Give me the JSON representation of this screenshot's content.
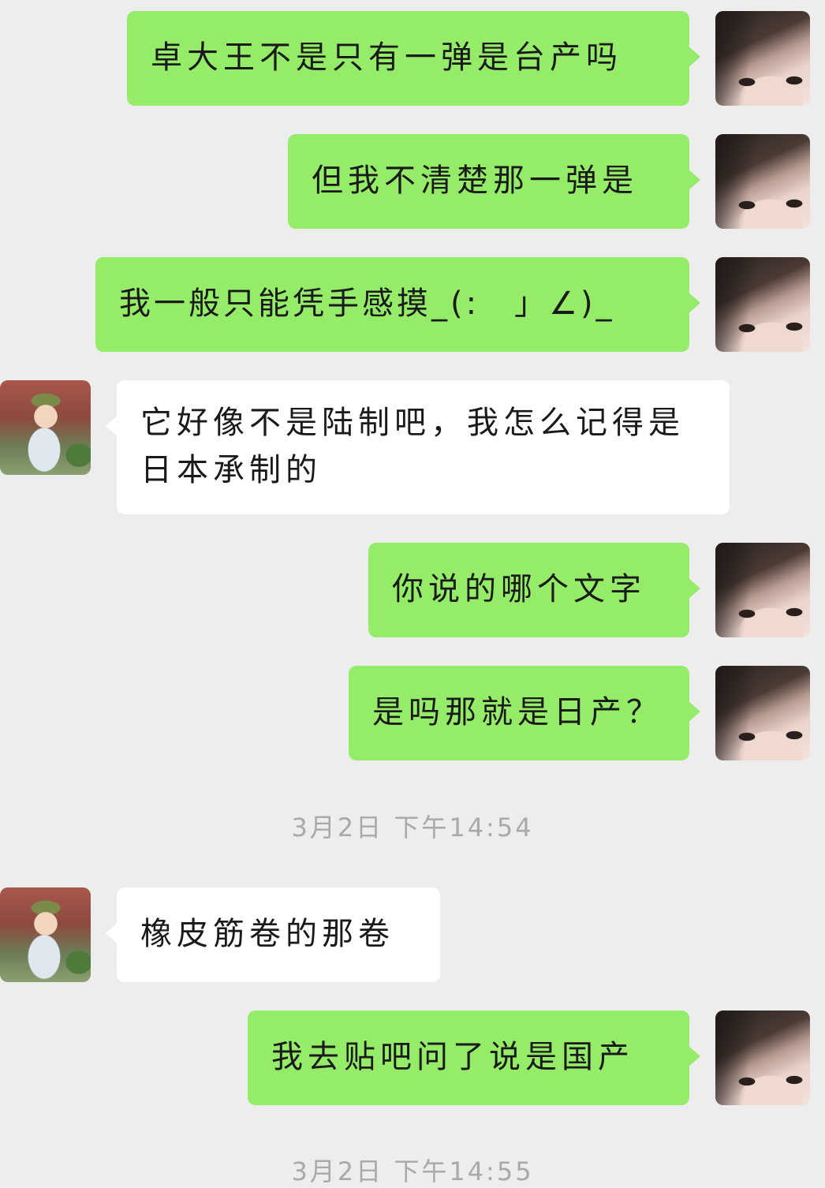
{
  "messages": [
    {
      "side": "self",
      "text": "卓大王不是只有一弹是台产吗"
    },
    {
      "side": "self",
      "text": "但我不清楚那一弹是"
    },
    {
      "side": "self",
      "text": "我一般只能凭手感摸_(:　」∠)_"
    },
    {
      "side": "other",
      "text": "它好像不是陆制吧，我怎么记得是日本承制的"
    },
    {
      "side": "self",
      "text": "你说的哪个文字"
    },
    {
      "side": "self",
      "text": "是吗那就是日产？"
    },
    {
      "side": "other",
      "text": "橡皮筋卷的那卷"
    },
    {
      "side": "self",
      "text": "我去贴吧问了说是国产"
    }
  ],
  "timestamps": {
    "t1": "3月2日  下午14:54",
    "t2": "3月2日  下午14:55"
  },
  "colors": {
    "background": "#ededed",
    "self_bubble": "#95ec69",
    "other_bubble": "#ffffff",
    "timestamp_text": "#a9a9a9"
  }
}
